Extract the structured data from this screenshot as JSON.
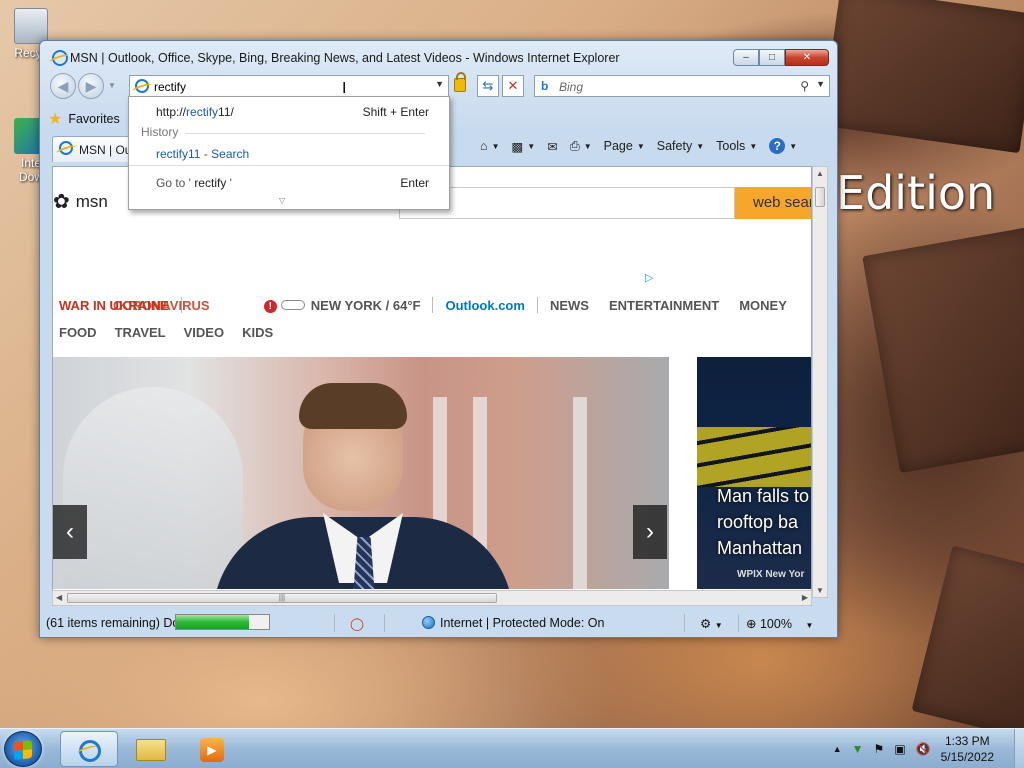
{
  "desktop": {
    "wallpaper_text": "Edition",
    "icons": [
      {
        "label": "Recycle Bin",
        "visible": "Recyc"
      },
      {
        "label": "Internet Download Manager",
        "visible1": "Inte",
        "visible2": "Dow"
      }
    ]
  },
  "window": {
    "title": "MSN | Outlook, Office, Skype, Bing, Breaking News, and Latest Videos - Windows Internet Explorer",
    "minimize": "‒",
    "maximize": "□",
    "close": "✕"
  },
  "address": {
    "value": "rectify",
    "dropdown_arrow": "▼"
  },
  "search": {
    "provider": "b",
    "placeholder": "Bing",
    "icon": "search-icon"
  },
  "favorites": {
    "label": "Favorites"
  },
  "tab": {
    "label": "MSN | Outlook"
  },
  "commands": {
    "page": "Page",
    "safety": "Safety",
    "tools": "Tools",
    "help": "?"
  },
  "autocomplete": {
    "url_prefix": "http://",
    "url_match": "rectify",
    "url_suffix": "11/",
    "url_shortcut": "Shift + Enter",
    "history_header": "History",
    "history_match": "rectify",
    "history_rest": "11 - Search",
    "goto_text": "Go to ' ",
    "goto_match": "rectify",
    "goto_end": " '",
    "goto_shortcut": "Enter",
    "more": "▽"
  },
  "msn": {
    "logo_text": "msn",
    "search_button": "web search",
    "nav_primary": {
      "war": "WAR IN UKRAINE",
      "corona": "CORONAVIRUS",
      "weather": "NEW YORK / 64°F",
      "outlook": "Outlook.com",
      "news": "NEWS",
      "entertainment": "ENTERTAINMENT",
      "money": "MONEY"
    },
    "nav_secondary": [
      "FOOD",
      "TRAVEL",
      "VIDEO",
      "KIDS"
    ],
    "carousel_prev": "‹",
    "carousel_next": "›",
    "side_story": {
      "line1": "Man falls to",
      "line2": "rooftop ba",
      "line3": "Manhattan",
      "source": "WPIX New Yor"
    }
  },
  "status": {
    "items": "(61 items remaining) Do",
    "progress": 0.78,
    "zone": "Internet | Protected Mode: On",
    "zoom": "100%"
  },
  "taskbar": {
    "time": "1:33 PM",
    "date": "5/15/2022"
  },
  "colors": {
    "accent": "#f4a72b",
    "link": "#0078c8",
    "alert": "#c8321e",
    "progress": "#2fb83a"
  }
}
